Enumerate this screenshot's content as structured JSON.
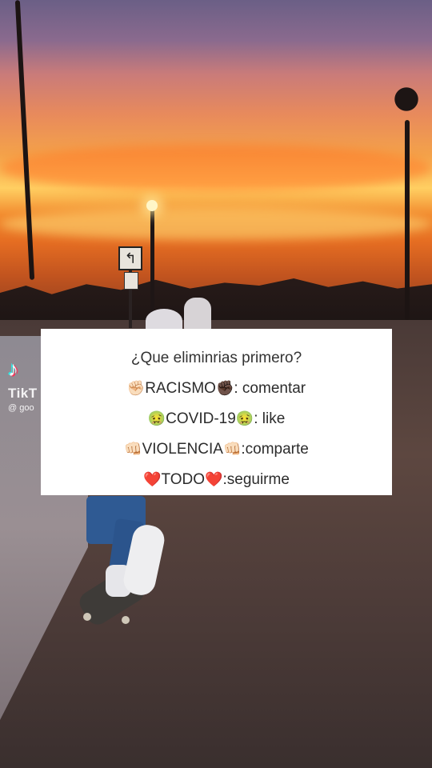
{
  "watermark": {
    "brand": "TikT",
    "handle": "@ goo"
  },
  "poll": {
    "question": "¿Que eliminrias primero?",
    "options": [
      {
        "left_emoji": "✊🏻",
        "label": "RACISMO",
        "right_emoji": "✊🏿",
        "action": ": comentar"
      },
      {
        "left_emoji": "🤢",
        "label": "COVID-19",
        "right_emoji": "🤢",
        "action": ": like"
      },
      {
        "left_emoji": "👊🏻",
        "label": "VIOLENCIA",
        "right_emoji": "👊🏻",
        "action": ":comparte"
      },
      {
        "left_emoji": "❤️",
        "label": "TODO",
        "right_emoji": "❤️",
        "action": ":seguirme"
      }
    ]
  },
  "colors": {
    "card_bg": "#ffffff",
    "text": "#2c2c2c",
    "tiktok_cyan": "#25f4ee",
    "tiktok_red": "#fe2c55"
  },
  "icons": [
    "tiktok-logo-icon"
  ]
}
